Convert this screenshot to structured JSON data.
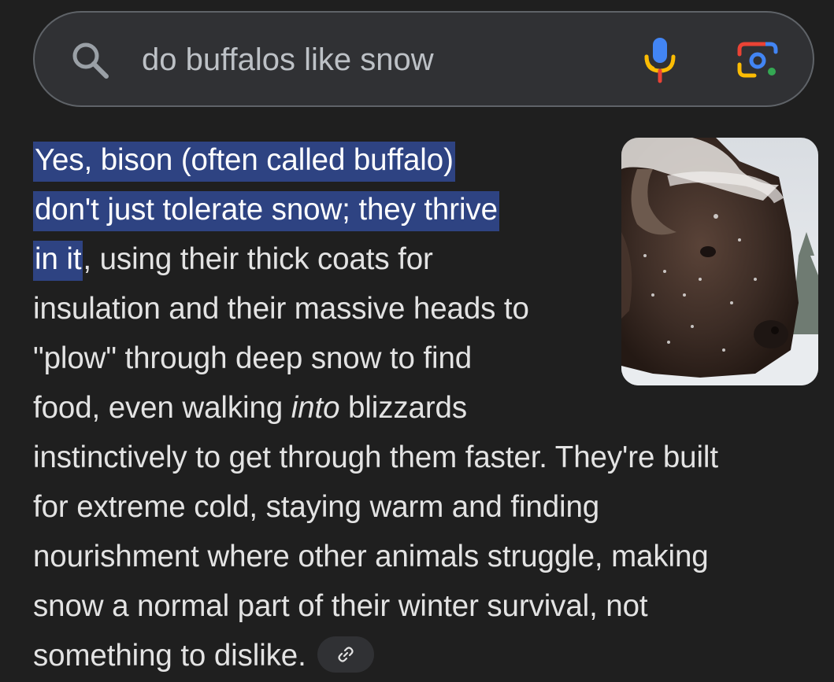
{
  "search": {
    "query": "do buffalos like snow",
    "search_icon": "search-icon",
    "mic_icon": "mic-icon",
    "lens_icon": "google-lens-icon"
  },
  "answer": {
    "highlighted_lines": [
      "Yes, bison (often called buffalo)",
      "don't just tolerate snow; they thrive",
      "in it"
    ],
    "line3_rest": ", using their thick coats for",
    "line4": "insulation and their massive heads to",
    "line5": "\"plow\" through deep snow to find",
    "line6_before": "food, even walking ",
    "line6_em": "into",
    "line6_after": " blizzards",
    "line7": "instinctively to get through them faster. They're built",
    "line8": "for extreme cold, staying warm and finding",
    "line9": "nourishment where other animals struggle, making",
    "line10": "snow a normal part of their winter survival, not",
    "line11": "something to dislike.",
    "link_icon": "link-icon",
    "highlight_color": "#2e4382"
  },
  "thumbnail": {
    "subject": "snow-covered bison head"
  },
  "colors": {
    "background": "#1f1f1f",
    "searchbar": "#303134",
    "text": "#e3e3e3"
  }
}
